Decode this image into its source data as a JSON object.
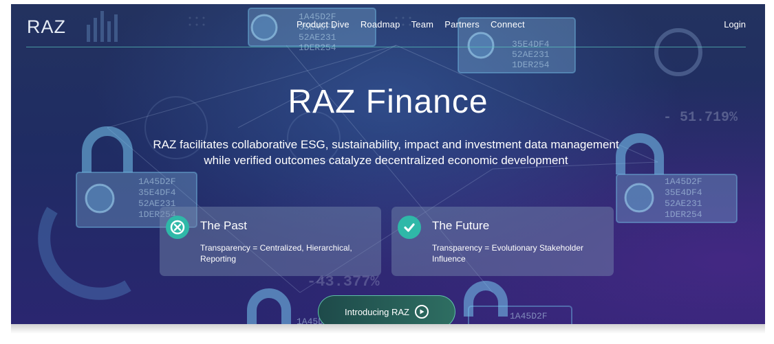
{
  "nav": {
    "logo": "RAZ",
    "links": [
      "Product Dive",
      "Roadmap",
      "Team",
      "Partners",
      "Connect"
    ],
    "login": "Login"
  },
  "hero": {
    "title": "RAZ Finance",
    "subtitle": "RAZ facilitates collaborative ESG, sustainability, impact and investment data management while verified outcomes catalyze decentralized economic development"
  },
  "cards": [
    {
      "icon": "x-circle-icon",
      "title": "The Past",
      "text": "Transparency = Centralized, Hierarchical, Reporting"
    },
    {
      "icon": "check-circle-icon",
      "title": "The Future",
      "text": "Transparency = Evolutionary Stakeholder Influence"
    }
  ],
  "cta": {
    "label": "Introducing RAZ",
    "icon": "play-icon"
  },
  "background": {
    "numbers": [
      "- 51.719%",
      "-43.377%"
    ],
    "hex_codes": [
      "1A45D2F",
      "35E4DF4",
      "52AE231",
      "1DER254"
    ]
  },
  "colors": {
    "accent": "#2fb8a8",
    "background": "#23325f"
  }
}
